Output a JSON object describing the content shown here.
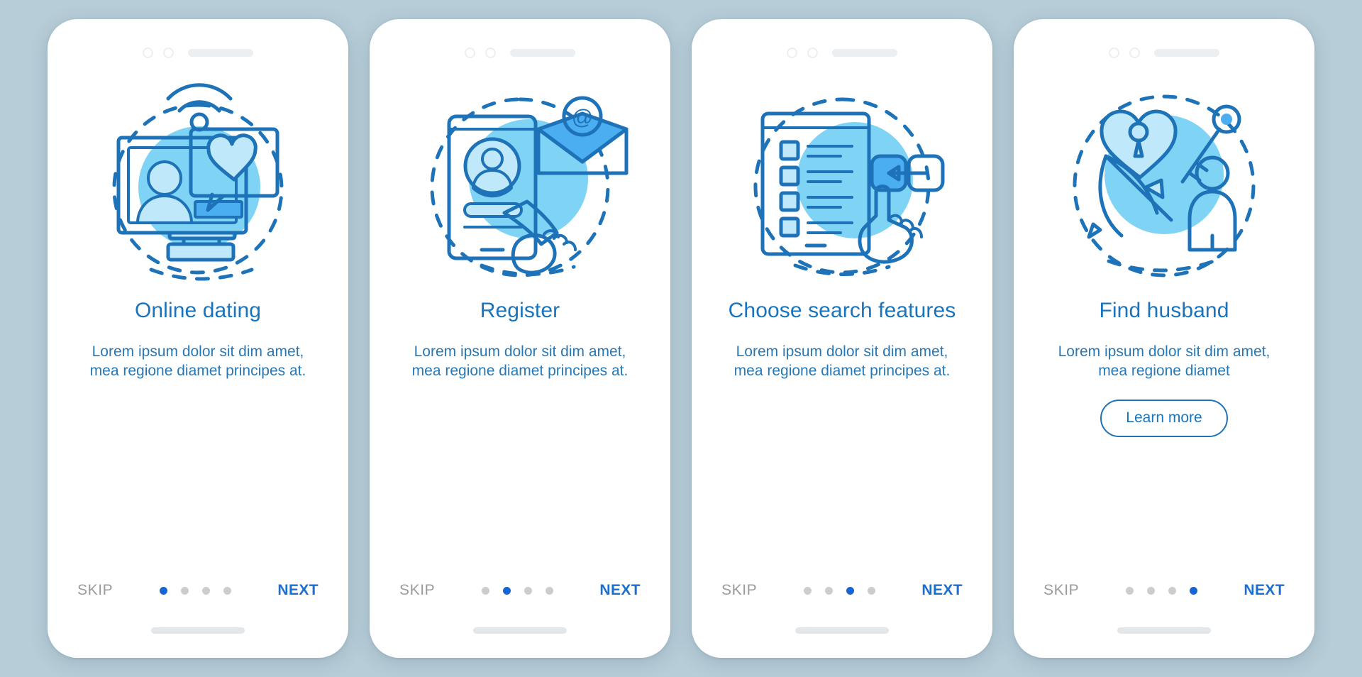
{
  "screens": [
    {
      "id": "online-dating",
      "illustration": "desktop-monitor-wifi-heart-chat-icon",
      "title": "Online dating",
      "body": "Lorem ipsum dolor sit dim amet, mea regione diamet principes at.",
      "skip_label": "SKIP",
      "next_label": "NEXT",
      "dots": 4,
      "active_dot": 1,
      "cta": null
    },
    {
      "id": "register",
      "illustration": "smartphone-profile-hand-tap-email-envelope-icon",
      "title": "Register",
      "body": "Lorem ipsum dolor sit dim amet, mea regione diamet principes at.",
      "skip_label": "SKIP",
      "next_label": "NEXT",
      "dots": 4,
      "active_dot": 2,
      "cta": null
    },
    {
      "id": "choose-search-features",
      "illustration": "tablet-checklist-hand-toggle-switch-icon",
      "title": "Choose search features",
      "body": "Lorem ipsum dolor sit dim amet, mea regione diamet principes at.",
      "skip_label": "SKIP",
      "next_label": "NEXT",
      "dots": 4,
      "active_dot": 3,
      "cta": null
    },
    {
      "id": "find-husband",
      "illustration": "heart-lock-key-bow-arrow-person-icon",
      "title": "Find husband",
      "body": "Lorem ipsum dolor sit dim amet, mea regione diamet",
      "skip_label": "SKIP",
      "next_label": "NEXT",
      "dots": 4,
      "active_dot": 4,
      "cta": "Learn more"
    }
  ],
  "colors": {
    "page_background": "#b7cdd8",
    "card_background": "#ffffff",
    "title": "#1a74bd",
    "body_text": "#2878b5",
    "skip": "#9b9b9b",
    "next": "#1a6fd0",
    "dot_inactive": "#cdcdcd",
    "dot_active": "#1565d8",
    "line_art": "#1d72b8",
    "accent_circle": "#7fd4f5",
    "accent_fill": "#4aaef0",
    "pale_fill": "#bfe9fa"
  }
}
